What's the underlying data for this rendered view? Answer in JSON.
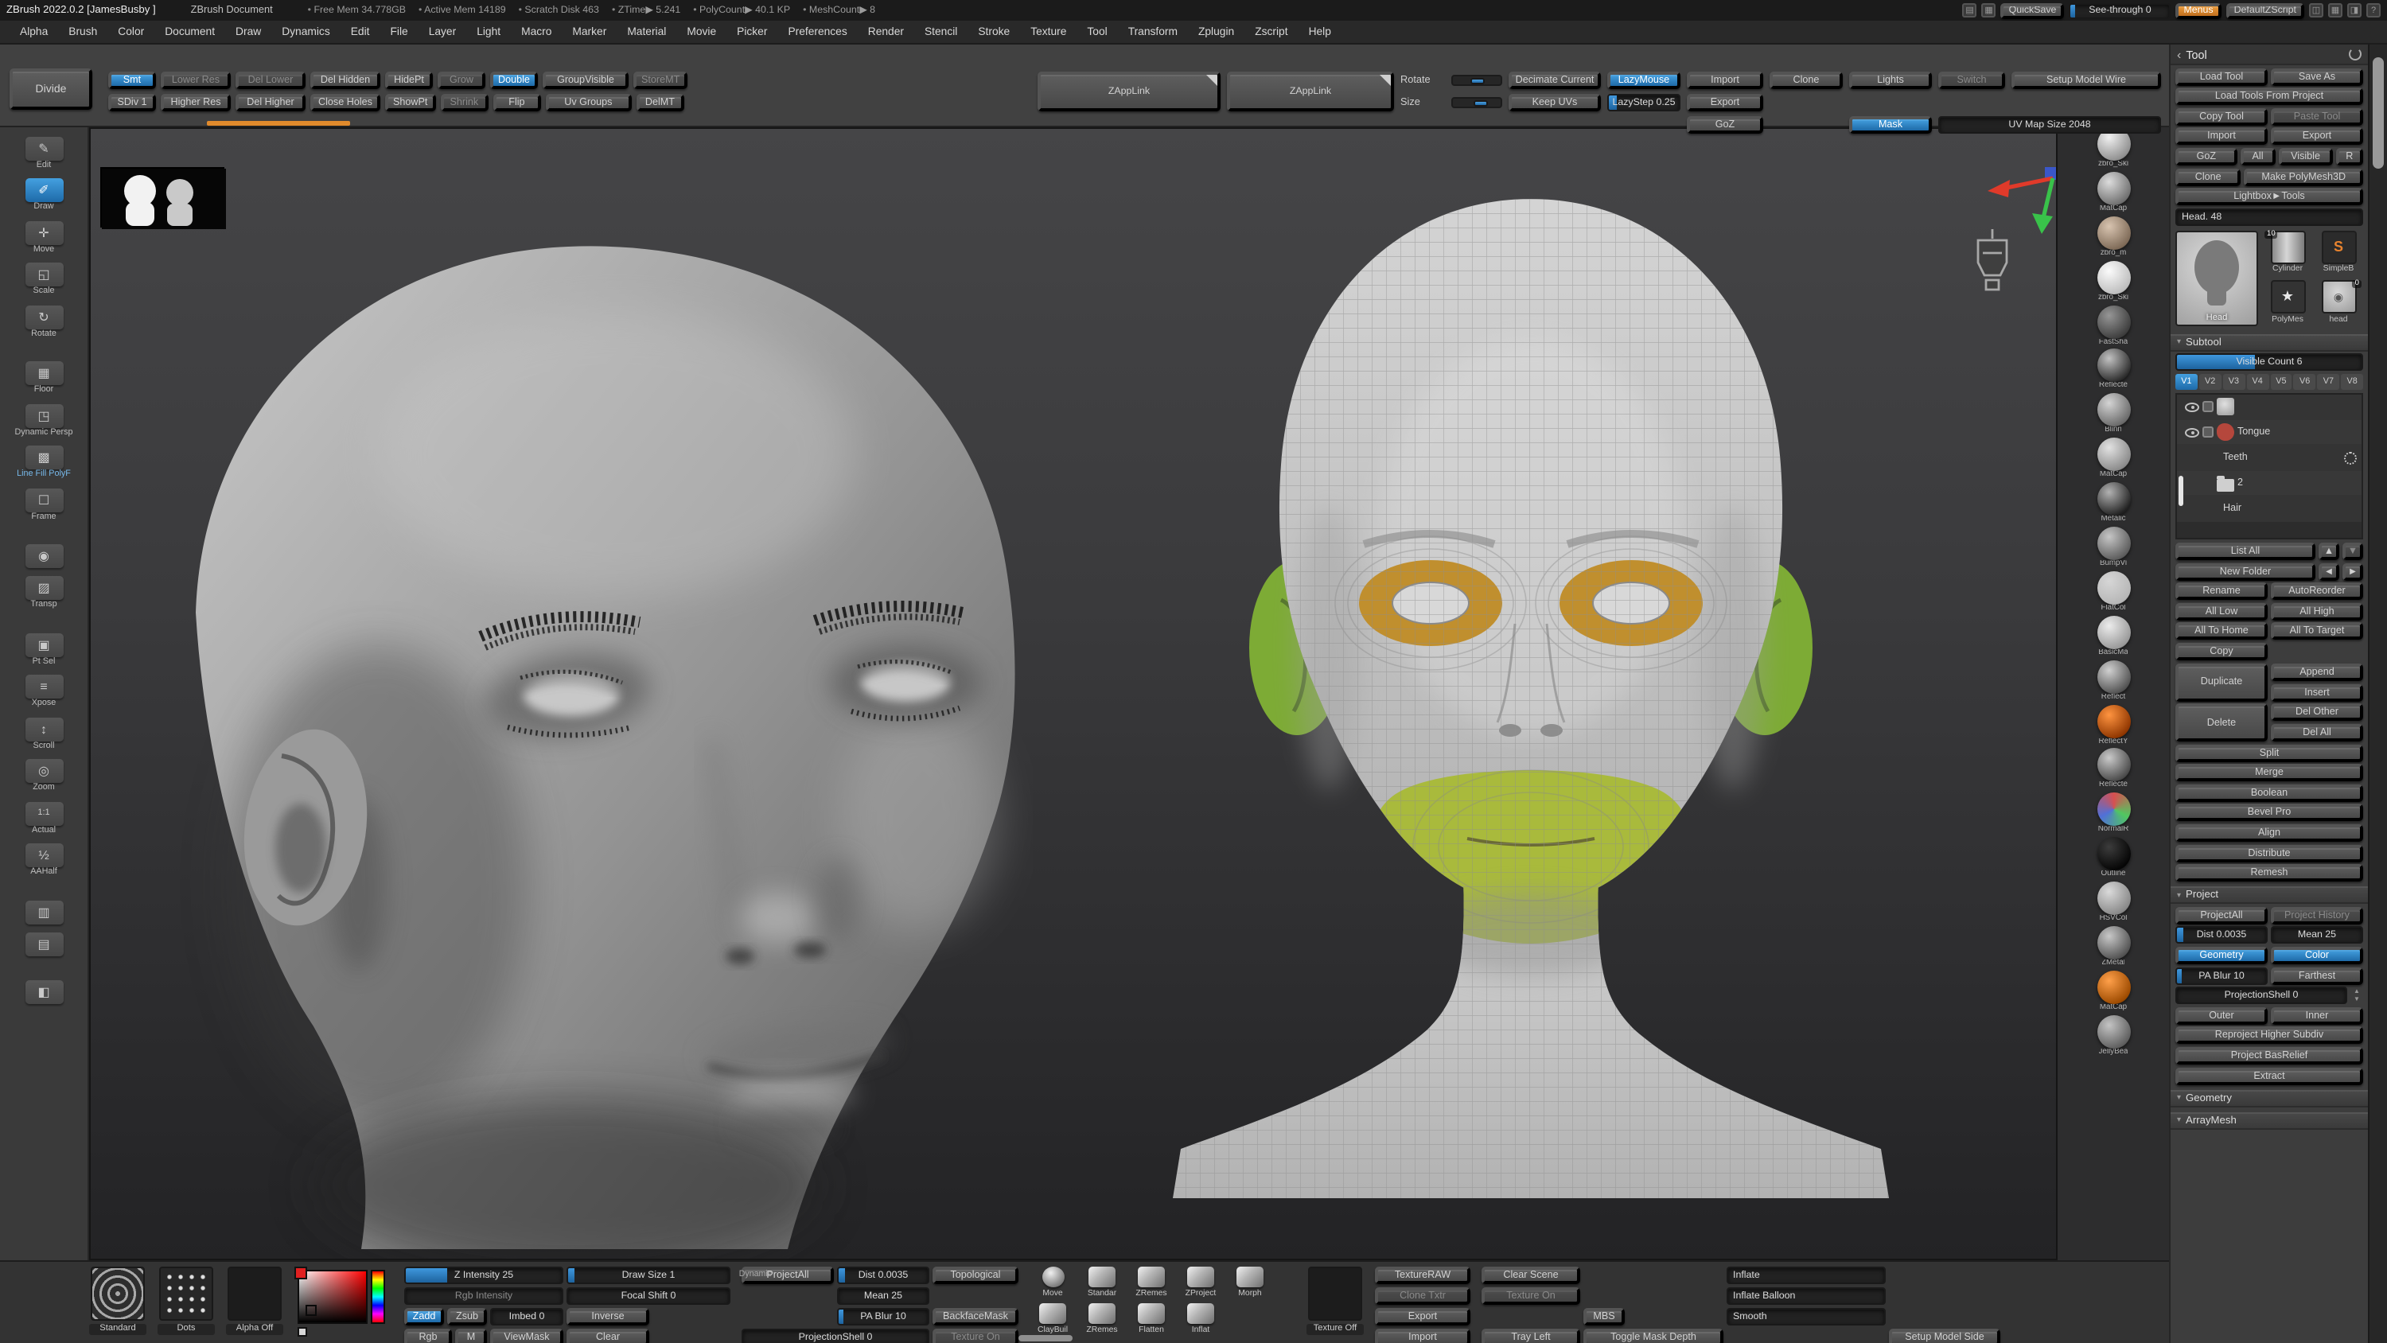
{
  "titlebar": {
    "app_title": "ZBrush 2022.0.2 [JamesBusby ]",
    "doc_name": "ZBrush Document",
    "stats": [
      "Free Mem 34.778GB",
      "Active Mem 14189",
      "Scratch Disk 463",
      "ZTime▶ 5.241",
      "PolyCount▶ 40.1 KP",
      "MeshCount▶ 8"
    ],
    "quicksave": "QuickSave",
    "see_through": "See-through 0",
    "menus": "Menus",
    "default_zscript": "DefaultZScript"
  },
  "menubar": {
    "items": [
      "Alpha",
      "Brush",
      "Color",
      "Document",
      "Draw",
      "Dynamics",
      "Edit",
      "File",
      "Layer",
      "Light",
      "Macro",
      "Marker",
      "Material",
      "Movie",
      "Picker",
      "Preferences",
      "Render",
      "Stencil",
      "Stroke",
      "Texture",
      "Tool",
      "Transform",
      "Zplugin",
      "Zscript",
      "Help"
    ]
  },
  "shelf": {
    "divide": "Divide",
    "row1": [
      {
        "label": "Smt",
        "cls": "on w-sm"
      },
      {
        "label": "Lower Res",
        "cls": "dim w-md"
      },
      {
        "label": "Del Lower",
        "cls": "dim w-md"
      },
      {
        "label": "Del Hidden",
        "cls": "w-md"
      },
      {
        "label": "HidePt"
      },
      {
        "label": "Grow",
        "cls": "dim"
      },
      {
        "label": "Double",
        "cls": "on"
      },
      {
        "label": "GroupVisible",
        "cls": "w-lg"
      },
      {
        "label": "StoreMT",
        "cls": "dim"
      }
    ],
    "row2": [
      {
        "label": "SDiv 1",
        "cls": "slider"
      },
      {
        "label": "Higher Res",
        "cls": "w-md"
      },
      {
        "label": "Del Higher",
        "cls": "w-md"
      },
      {
        "label": "Close Holes",
        "cls": "w-md"
      },
      {
        "label": "ShowPt"
      },
      {
        "label": "Shrink",
        "cls": "dim"
      },
      {
        "label": "Flip"
      },
      {
        "label": "Uv Groups",
        "cls": "w-lg"
      },
      {
        "label": "DelMT"
      }
    ],
    "rotate_label": "Rotate",
    "size_label": "Size",
    "decimate": "Decimate Current",
    "keep_uvs": "Keep UVs",
    "lazymouse": "LazyMouse",
    "lazystep": "LazyStep 0.25",
    "import_btn": "Import",
    "export_btn": "Export",
    "zapplink_a": "ZAppLink",
    "clone_btn": "Clone",
    "goz_btn": "GoZ",
    "zapplink_b": "ZAppLink",
    "lights": "Lights",
    "mask": "Mask",
    "switch_btn": "Switch",
    "setup_model_wire": "Setup Model Wire",
    "uv_map_size": "UV Map Size 2048"
  },
  "fills": {
    "sdiv": 22,
    "rotate": 38,
    "size": 42,
    "see_through": 4,
    "lazystep": 12,
    "z_intensity": 27,
    "rgb_intensity": 0,
    "imbed": 0,
    "draw_size": 4,
    "focal_shift": 0,
    "visible_count": 42,
    "dist": 8,
    "mean": 0,
    "pa_blur": 6,
    "projection_shell": 0,
    "dist_b": 8,
    "mean_b": 0,
    "pa_blur_b": 6,
    "projection_shell_b": 0,
    "inflate": 0,
    "inflate_balloon": 0,
    "smooth": 0
  },
  "left_rail": {
    "items": [
      {
        "label": "Edit",
        "icon": "pencil"
      },
      {
        "label": "Draw",
        "icon": "brush",
        "cls": "on"
      },
      {
        "label": "Move",
        "icon": "move"
      },
      {
        "label": "Scale",
        "icon": "scale"
      },
      {
        "label": "Rotate",
        "icon": "rotate"
      },
      {
        "label": "Floor",
        "icon": "floor",
        "cls": "gap"
      },
      {
        "label": "Dynamic Persp",
        "icon": "persp"
      },
      {
        "label": "Line Fill PolyF",
        "icon": "polyf",
        "cls": "accent"
      },
      {
        "label": "Frame",
        "icon": "frame"
      },
      {
        "label": "",
        "icon": "camera",
        "cls": "gap"
      },
      {
        "label": "Transp",
        "icon": "transp"
      },
      {
        "label": "Pt Sel",
        "icon": "ptsel",
        "cls": "gap"
      },
      {
        "label": "Xpose",
        "icon": "xpose"
      },
      {
        "label": "Scroll",
        "icon": "scroll"
      },
      {
        "label": "Zoom",
        "icon": "zoom"
      },
      {
        "label": "Actual",
        "icon": "actual"
      },
      {
        "label": "AAHalf",
        "icon": "aahalf"
      },
      {
        "label": "",
        "icon": "brush2",
        "cls": "gap"
      },
      {
        "label": "",
        "icon": "doc"
      },
      {
        "label": "",
        "icon": "cube",
        "cls": "gap"
      }
    ]
  },
  "matcaps": {
    "items": [
      {
        "label": "zbro_Ski",
        "c1": "#f0f0f0",
        "c2": "#8f8f8f"
      },
      {
        "label": "MatCap",
        "c1": "#dcdcdc",
        "c2": "#6f6f6f"
      },
      {
        "label": "zbro_m",
        "c1": "#d8c4b0",
        "c2": "#7e6a57"
      },
      {
        "label": "zbro_Ski",
        "c1": "#fbfbfb",
        "c2": "#bdbdbd"
      },
      {
        "label": "FastSha",
        "c1": "#969696",
        "c2": "#3d3d3d"
      },
      {
        "label": "Reflecte",
        "c1": "#c2c2c2",
        "c2": "#2c2c2c"
      },
      {
        "label": "Blinn",
        "c1": "#d4d4d4",
        "c2": "#6a6a6a"
      },
      {
        "label": "MatCap",
        "c1": "#e2e2e2",
        "c2": "#8a8a8a"
      },
      {
        "label": "Metalic",
        "c1": "#b2b2b2",
        "c2": "#222222"
      },
      {
        "label": "BumpVi",
        "c1": "#c6c6c6",
        "c2": "#5c5c5c"
      },
      {
        "label": "FlatCol",
        "c1": "#d6d6d6",
        "c2": "#b6b6b6"
      },
      {
        "label": "BasicMa",
        "c1": "#ececec",
        "c2": "#989898"
      },
      {
        "label": "Reflect",
        "c1": "#d0d0d0",
        "c2": "#525252"
      },
      {
        "label": "ReflectY",
        "c1": "#ff9440",
        "c2": "#8f3600"
      },
      {
        "label": "Reflecte",
        "c1": "#cacaca",
        "c2": "#4a4a4a"
      },
      {
        "label": "NormalR",
        "type": "rgb",
        "c1": "#d85050",
        "c2": "#5070d8"
      },
      {
        "label": "Outline",
        "c1": "#3c3c3c",
        "c2": "#050505"
      },
      {
        "label": "HSVCol",
        "c1": "#dadada",
        "c2": "#888888"
      },
      {
        "label": "ZMetal",
        "c1": "#c8c8c8",
        "c2": "#525252"
      },
      {
        "label": "MatCap",
        "c1": "#ffa04a",
        "c2": "#9c4a00"
      },
      {
        "label": "JellyBea",
        "c1": "#c4c4c4",
        "c2": "#5e5e5e"
      }
    ]
  },
  "tool_panel": {
    "title": "Tool",
    "load_tool": "Load Tool",
    "save_as": "Save As",
    "load_from_project": "Load Tools From Project",
    "copy_tool": "Copy Tool",
    "paste_tool": "Paste Tool",
    "import": "Import",
    "export": "Export",
    "goz": "GoZ",
    "all": "All",
    "visible": "Visible",
    "r": "R",
    "clone": "Clone",
    "make_polymesh": "Make PolyMesh3D",
    "lightbox_tools": "Lightbox►Tools",
    "head_slider": "Head. 48",
    "big_thumb_label": "Head",
    "badge_10": "10",
    "badge_0": "0",
    "thumb_cylinder": "Cylinder",
    "thumb_simpleb": "SimpleB",
    "thumb_simpleb_glyph": "S",
    "thumb_polymes": "PolyMes",
    "thumb_polymes_glyph": "★",
    "thumb_head": "head",
    "subtool": {
      "header": "Subtool",
      "visible_count": "Visible Count 6",
      "tabs": [
        {
          "label": "V1",
          "cls": "on"
        },
        {
          "label": "V2"
        },
        {
          "label": "V3"
        },
        {
          "label": "V4"
        },
        {
          "label": "V5"
        },
        {
          "label": "V6"
        },
        {
          "label": "V7"
        },
        {
          "label": "V8"
        }
      ],
      "items": [
        {
          "name": "",
          "thumb": "head",
          "eye": true,
          "brush": true
        },
        {
          "name": "Tongue",
          "thumb": "tongue",
          "eye": true,
          "brush": true
        },
        {
          "name": "Teeth",
          "thumb": "none",
          "gear": true
        },
        {
          "name": "2",
          "thumb": "folder"
        },
        {
          "name": "Hair",
          "thumb": "none"
        }
      ],
      "list_all": "List All",
      "up": "▲",
      "down": "▼",
      "new_folder": "New Folder",
      "left": "◄",
      "right": "►",
      "rename": "Rename",
      "autoreorder": "AutoReorder",
      "all_low": "All Low",
      "all_high": "All High",
      "all_to_home": "All To Home",
      "all_to_target": "All To Target",
      "copy": "Copy",
      "duplicate": "Duplicate",
      "append": "Append",
      "insert": "Insert",
      "delete": "Delete",
      "del_other": "Del Other",
      "del_all": "Del All",
      "split": "Split",
      "merge": "Merge",
      "boolean": "Boolean",
      "bevel_pro": "Bevel Pro",
      "align": "Align",
      "distribute": "Distribute",
      "remesh": "Remesh"
    },
    "project": {
      "header": "Project",
      "project_all": "ProjectAll",
      "project_history": "Project History",
      "dist": "Dist 0.0035",
      "mean": "Mean 25",
      "geometry": "Geometry",
      "color": "Color",
      "pa_blur": "PA Blur 10",
      "farthest": "Farthest",
      "projection_shell": "ProjectionShell 0",
      "outer": "Outer",
      "inner": "Inner",
      "reproject": "Reproject Higher Subdiv",
      "bas_relief": "Project BasRelief",
      "extract": "Extract"
    },
    "geometry_header": "Geometry",
    "arraymesh_header": "ArrayMesh"
  },
  "tray": {
    "brush_label": "Standard",
    "stroke_label": "Dots",
    "alpha_label": "Alpha Off",
    "z_intensity": "Z Intensity 25",
    "rgb_intensity": "Rgb Intensity",
    "draw_size": "Draw Size 1",
    "dynamic": "Dynamic",
    "focal_shift": "Focal Shift 0",
    "zadd": "Zadd",
    "zsub": "Zsub",
    "rgb": "Rgb",
    "m": "M",
    "imbed": "Imbed 0",
    "inverse": "Inverse",
    "viewmask": "ViewMask",
    "clear": "Clear",
    "project_all": "ProjectAll",
    "dist": "Dist 0.0035",
    "mean": "Mean 25",
    "pa_blur": "PA Blur 10",
    "projection_shell": "ProjectionShell 0",
    "topological": "Topological",
    "backface_mask": "BackfaceMask",
    "texture_on_a": "Texture On",
    "quick_row1": [
      {
        "label": "Move",
        "icon": "sphere"
      },
      {
        "label": "Standar"
      },
      {
        "label": "ZRemes"
      },
      {
        "label": "ZProject"
      },
      {
        "label": "Morph"
      }
    ],
    "quick_row2": [
      {
        "label": "ClayBuil"
      },
      {
        "label": "ZRemes"
      },
      {
        "label": "Flatten"
      },
      {
        "label": "Inflat"
      }
    ],
    "texture_off": "Texture Off",
    "texture_raw": "TextureRAW",
    "clone_txtr": "Clone Txtr",
    "export": "Export",
    "import": "Import",
    "clear_scene": "Clear Scene",
    "texture_on_b": "Texture On",
    "mbs": "MBS",
    "tray_left": "Tray Left",
    "toggle_mask_depth": "Toggle Mask Depth",
    "inflate": "Inflate",
    "inflate_balloon": "Inflate Balloon",
    "smooth": "Smooth",
    "setup_model_side": "Setup Model Side"
  }
}
